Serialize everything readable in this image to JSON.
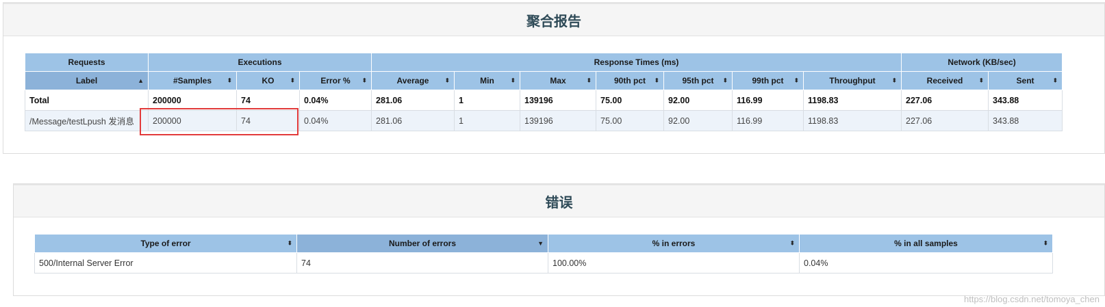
{
  "stats_panel": {
    "title": "聚合报告",
    "group_headers": [
      "Requests",
      "Executions",
      "Response Times (ms)",
      "Network (KB/sec)"
    ],
    "columns": [
      "Label",
      "#Samples",
      "KO",
      "Error %",
      "Average",
      "Min",
      "Max",
      "90th pct",
      "95th pct",
      "99th pct",
      "Throughput",
      "Received",
      "Sent"
    ],
    "sorted_column": "Label",
    "rows": [
      {
        "type": "total",
        "cells": [
          "Total",
          "200000",
          "74",
          "0.04%",
          "281.06",
          "1",
          "139196",
          "75.00",
          "92.00",
          "116.99",
          "1198.83",
          "227.06",
          "343.88"
        ]
      },
      {
        "type": "request",
        "cells": [
          "/Message/testLpush 发消息",
          "200000",
          "74",
          "0.04%",
          "281.06",
          "1",
          "139196",
          "75.00",
          "92.00",
          "116.99",
          "1198.83",
          "227.06",
          "343.88"
        ]
      }
    ]
  },
  "errors_panel": {
    "title": "错误",
    "columns": [
      "Type of error",
      "Number of errors",
      "% in errors",
      "% in all samples"
    ],
    "sorted_column": "Number of errors",
    "rows": [
      {
        "cells": [
          "500/Internal Server Error",
          "74",
          "100.00%",
          "0.04%"
        ]
      }
    ]
  },
  "watermark": "https://blog.csdn.net/tomoya_chen",
  "colors": {
    "header": "#9dc3e6",
    "header_sorted": "#8cb2d9",
    "stripe": "#edf3fa",
    "highlight": "#e23a3a",
    "title": "#2e4a57"
  },
  "icons": {
    "sort_both": "sort-icon",
    "sort_asc": "sort-asc-icon",
    "sort_desc": "sort-desc-icon"
  }
}
